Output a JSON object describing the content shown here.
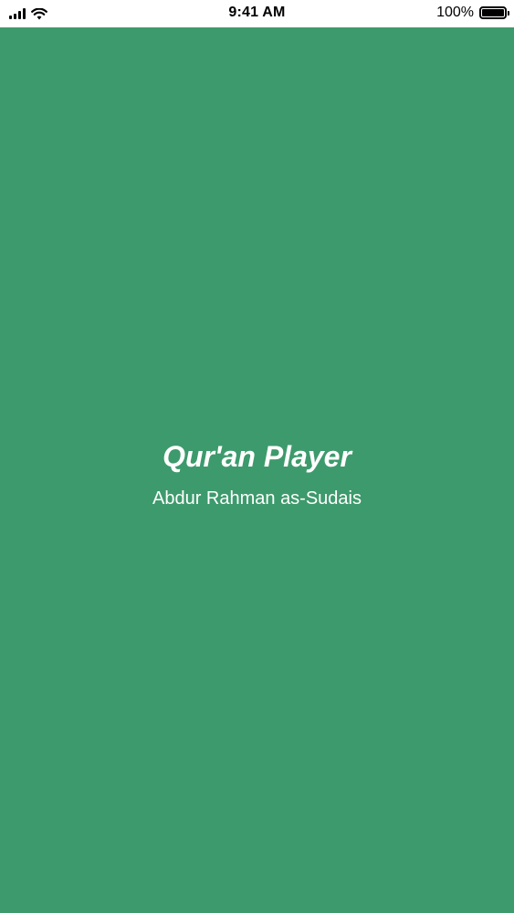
{
  "status_bar": {
    "time": "9:41 AM",
    "battery_text": "100%",
    "icons": [
      "signal-icon",
      "wifi-icon",
      "battery-icon"
    ]
  },
  "splash": {
    "title": "Qur'an Player",
    "subtitle": "Abdur Rahman as-Sudais"
  },
  "colors": {
    "background": "#3d9a6c",
    "text": "#ffffff",
    "status_bar": "#ffffff"
  }
}
